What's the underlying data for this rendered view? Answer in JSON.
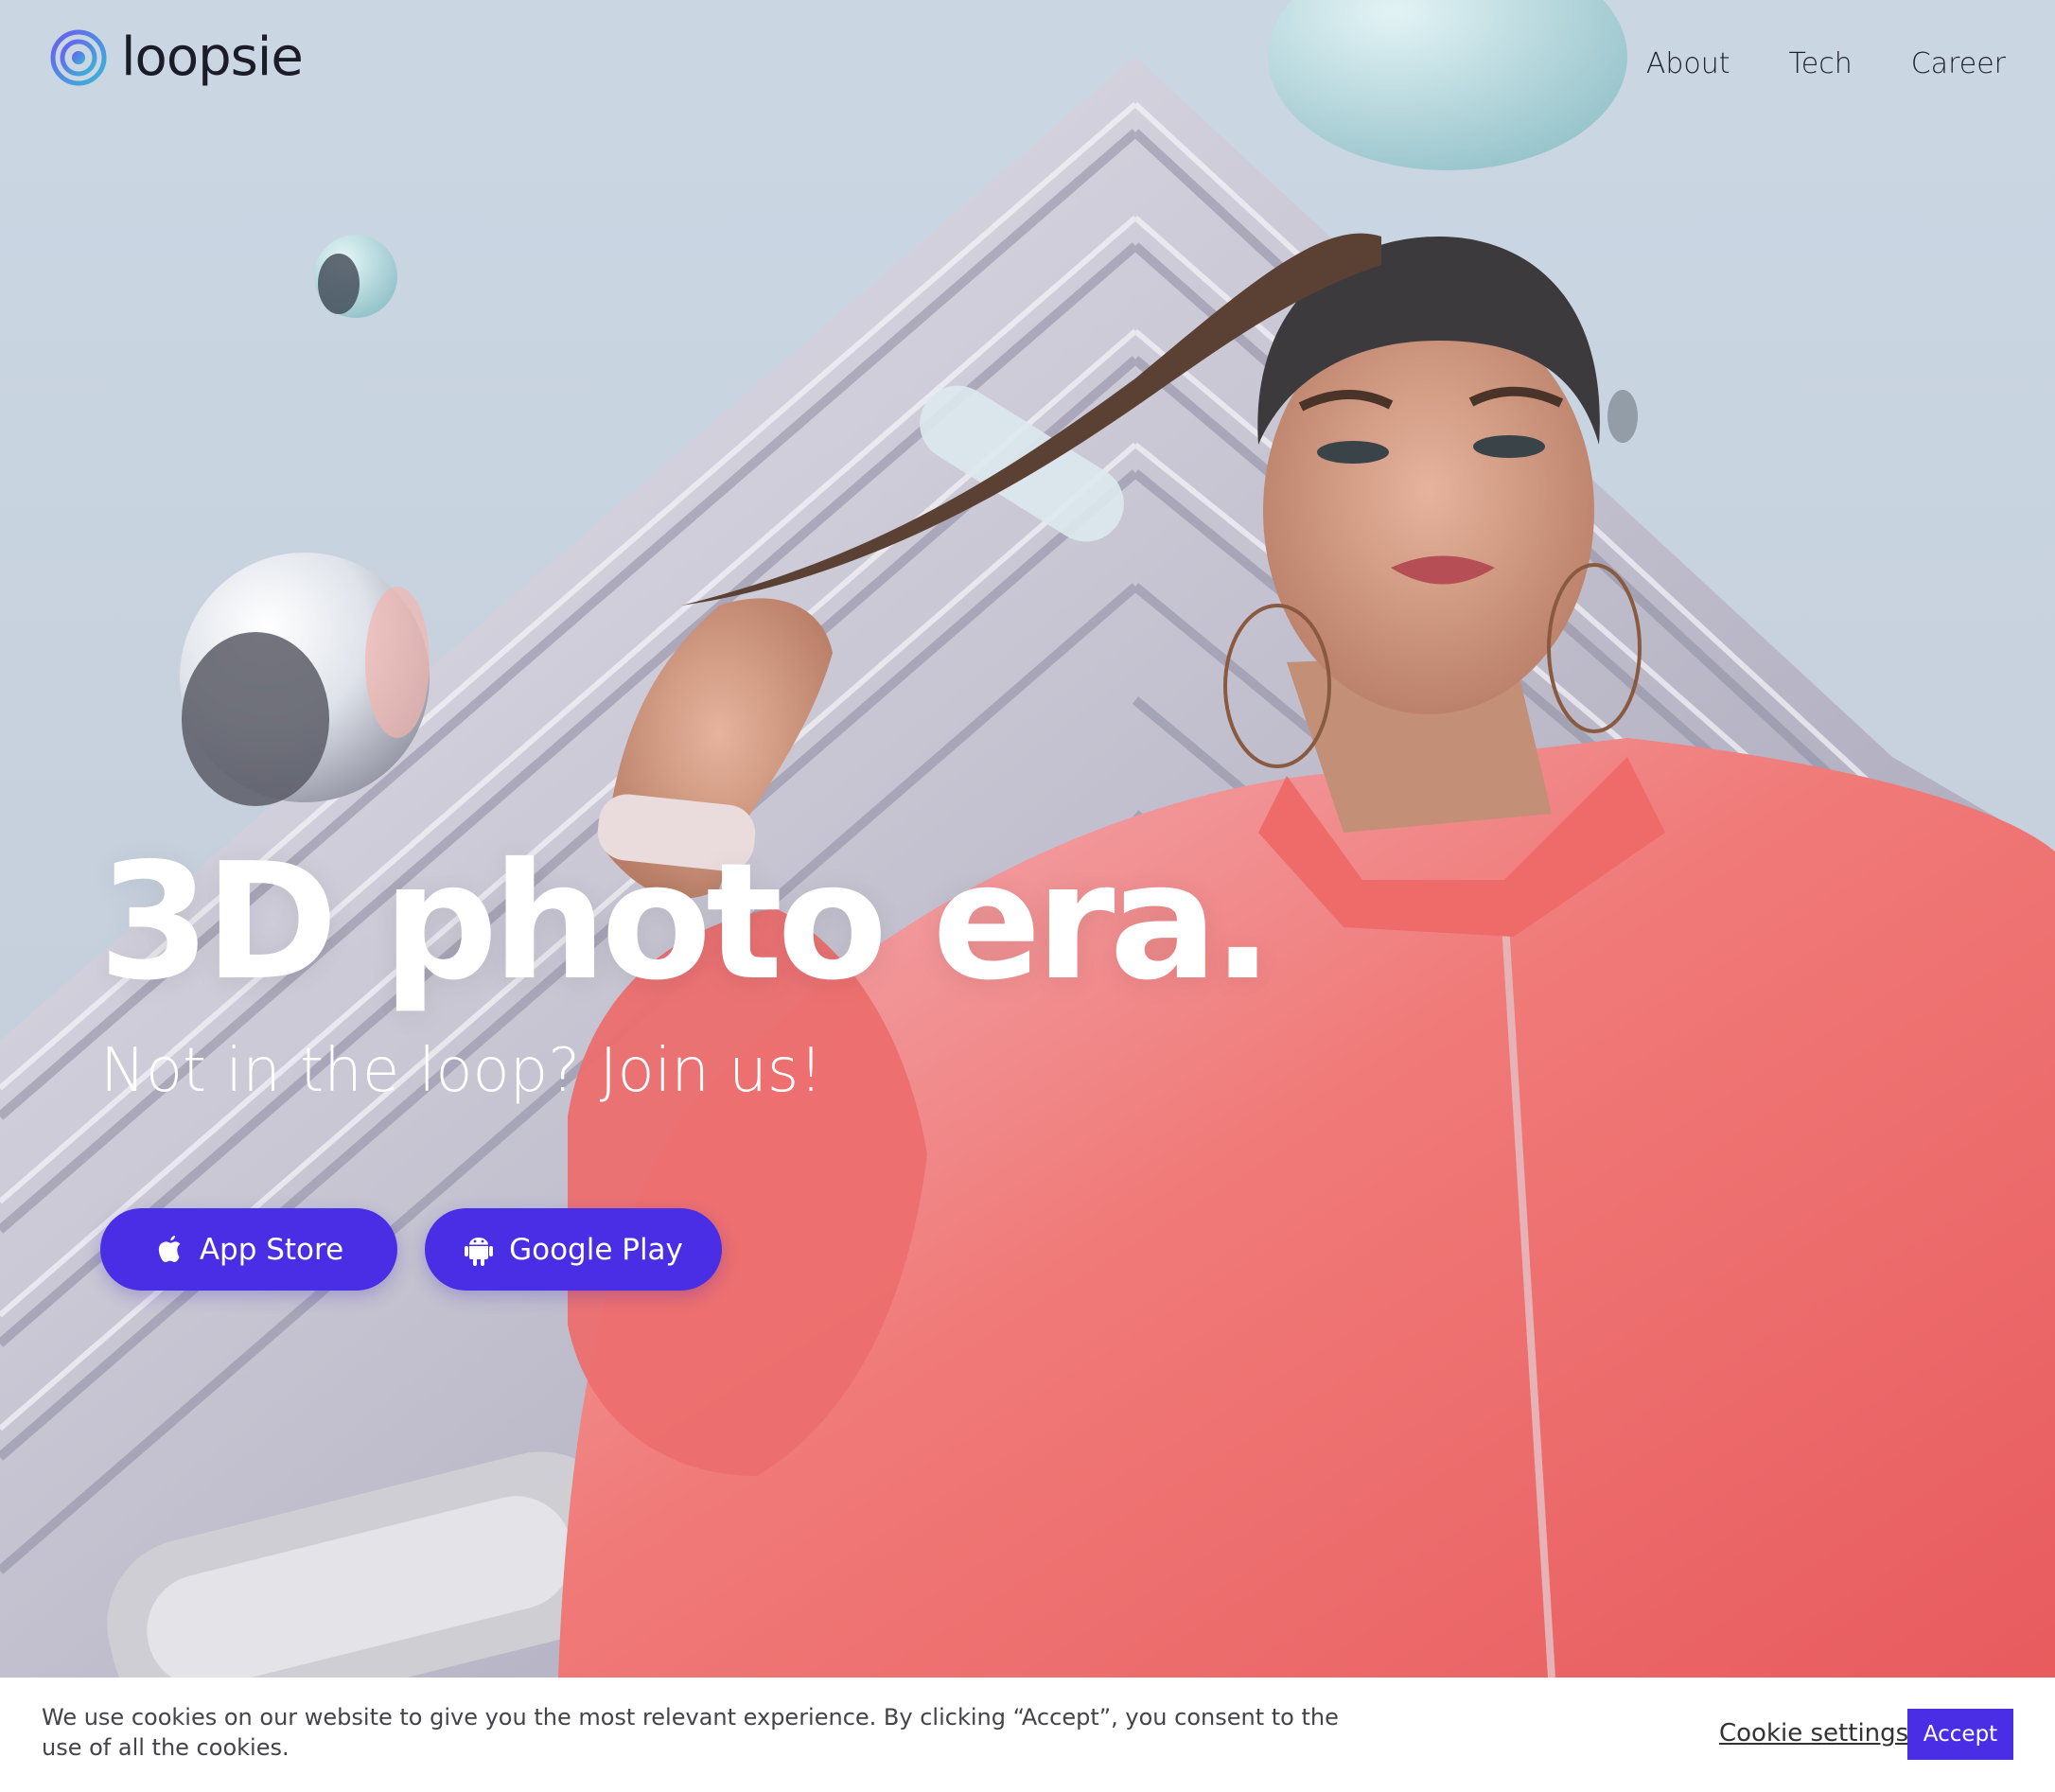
{
  "brand": {
    "name": "loopsie",
    "accent_color": "#4a2ee6"
  },
  "nav": {
    "items": [
      "About",
      "Tech",
      "Career"
    ]
  },
  "hero": {
    "headline": "3D photo era.",
    "subheadline": "Not in the loop? Join us!",
    "buttons": {
      "app_store": {
        "label": "App Store",
        "icon": "apple-icon"
      },
      "google_play": {
        "label": "Google Play",
        "icon": "android-icon"
      }
    },
    "background_image": "woman in pink jacket in front of building with floating glass bubbles"
  },
  "cookie_banner": {
    "text": "We use cookies on our website to give you the most relevant experience. By clicking “Accept”, you consent to the use of all the cookies.",
    "settings_label": "Cookie settings",
    "accept_label": "Accept"
  }
}
